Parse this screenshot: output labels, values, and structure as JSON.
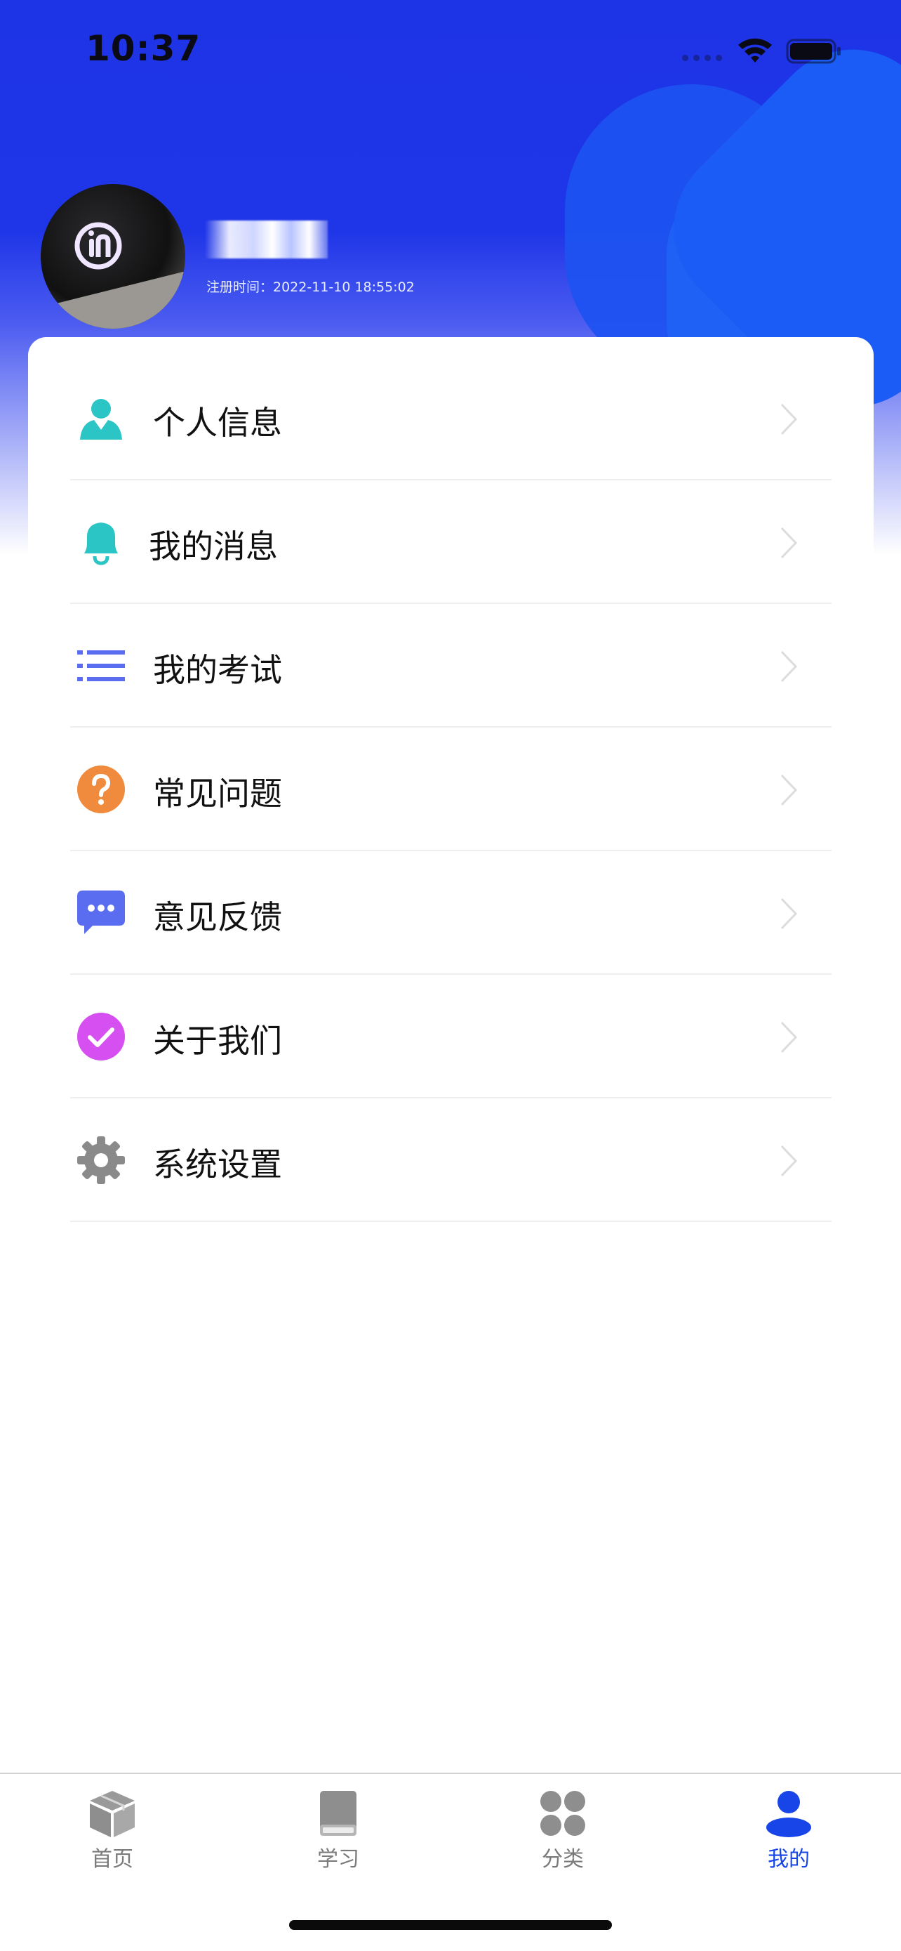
{
  "status_bar": {
    "time": "10:37"
  },
  "profile": {
    "username": "",
    "register_time": "注册时间：2022-11-10 18:55:02"
  },
  "menu": [
    {
      "label": "个人信息",
      "icon": "user-icon",
      "color": "#2bc5c5"
    },
    {
      "label": "我的消息",
      "icon": "bell-icon",
      "color": "#2bc5c5"
    },
    {
      "label": "我的考试",
      "icon": "list-icon",
      "color": "#5a6df0"
    },
    {
      "label": "常见问题",
      "icon": "question-icon",
      "color": "#f08a3c"
    },
    {
      "label": "意见反馈",
      "icon": "chat-bubble-icon",
      "color": "#5a6df0"
    },
    {
      "label": "关于我们",
      "icon": "check-circle-icon",
      "color": "#d64ff0"
    },
    {
      "label": "系统设置",
      "icon": "gear-icon",
      "color": "#8a8a8a"
    }
  ],
  "tabbar": {
    "items": [
      {
        "label": "首页",
        "icon": "box-icon",
        "active": false
      },
      {
        "label": "学习",
        "icon": "book-icon",
        "active": false
      },
      {
        "label": "分类",
        "icon": "grid-icon",
        "active": false
      },
      {
        "label": "我的",
        "icon": "person-icon",
        "active": true
      }
    ],
    "active_color": "#1745e8",
    "inactive_color": "#8e8e8e"
  }
}
